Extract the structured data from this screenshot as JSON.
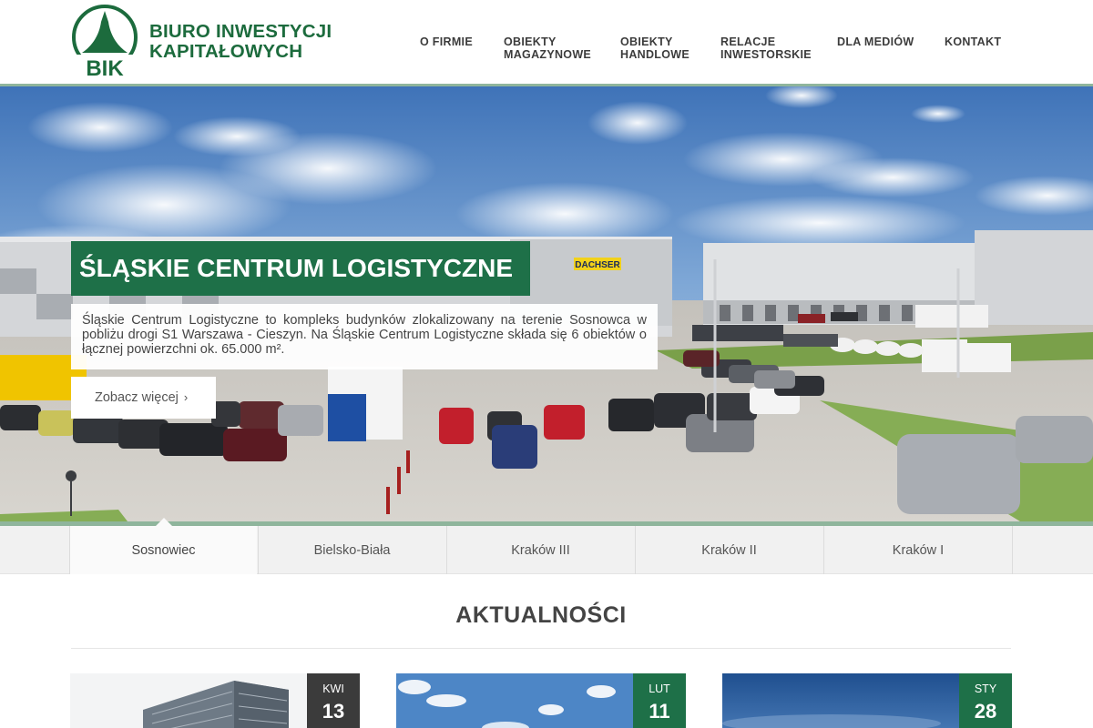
{
  "header": {
    "logo_line1": "BIURO INWESTYCJI",
    "logo_line2": "KAPITAŁOWYCH",
    "logo_mark_text": "BIK",
    "brand_color": "#1c6b3d"
  },
  "nav": [
    {
      "line1": "O FIRMIE",
      "line2": ""
    },
    {
      "line1": "OBIEKTY",
      "line2": "MAGAZYNOWE"
    },
    {
      "line1": "OBIEKTY",
      "line2": "HANDLOWE"
    },
    {
      "line1": "RELACJE",
      "line2": "INWESTORSKIE"
    },
    {
      "line1": "DLA MEDIÓW",
      "line2": ""
    },
    {
      "line1": "KONTAKT",
      "line2": ""
    }
  ],
  "hero": {
    "title": "ŚLĄSKIE CENTRUM LOGISTYCZNE",
    "description": "Śląskie Centrum Logistyczne to kompleks budynków zlokalizowany na terenie Sosnowca w pobliżu drogi S1 Warszawa - Cieszyn. Na Śląskie Centrum Logistyczne składa się 6 obiektów o łącznej powierzchni ok. 65.000 m².",
    "button_label": "Zobacz więcej",
    "building_sign": "DACHSER",
    "title_bg": "#1e7048"
  },
  "tabs": [
    {
      "label": "Sosnowiec",
      "active": true
    },
    {
      "label": "Bielsko-Biała",
      "active": false
    },
    {
      "label": "Kraków III",
      "active": false
    },
    {
      "label": "Kraków II",
      "active": false
    },
    {
      "label": "Kraków I",
      "active": false
    }
  ],
  "news": {
    "heading": "AKTUALNOŚCI",
    "items": [
      {
        "month": "KWI",
        "day": "13",
        "badge_color": "#3b3b3b"
      },
      {
        "month": "LUT",
        "day": "11",
        "badge_color": "#1e7048"
      },
      {
        "month": "STY",
        "day": "28",
        "badge_color": "#1e7048"
      }
    ]
  }
}
